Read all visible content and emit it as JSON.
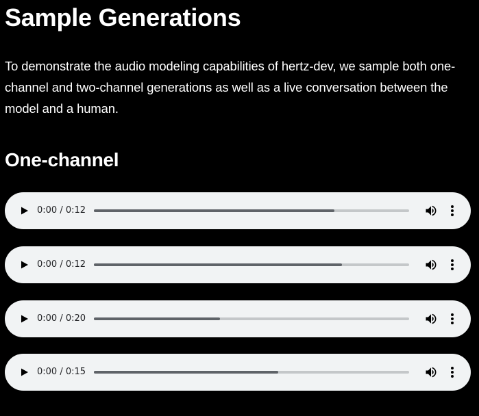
{
  "page": {
    "title": "Sample Generations",
    "intro": "To demonstrate the audio modeling capabilities of hertz-dev, we sample both one-channel and two-channel generations as well as a live conversation between the model and a human."
  },
  "sections": [
    {
      "title": "One-channel",
      "players": [
        {
          "time": "0:00 / 0:12",
          "progress": 0.763
        },
        {
          "time": "0:00 / 0:12",
          "progress": 0.786
        },
        {
          "time": "0:00 / 0:20",
          "progress": 0.401
        },
        {
          "time": "0:00 / 0:15",
          "progress": 0.585
        }
      ]
    }
  ],
  "icons": {
    "play": "play-icon",
    "volume": "volume-icon",
    "more": "more-vert-icon"
  },
  "colors": {
    "background": "#000000",
    "text": "#ffffff",
    "player_background": "#f1f3f4",
    "track": "#c4c7c9",
    "track_fill": "#5f6368",
    "player_text": "#202124"
  }
}
